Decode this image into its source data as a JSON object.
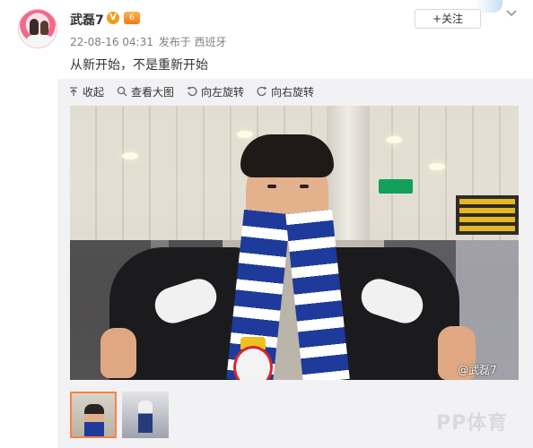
{
  "header": {
    "username": "武磊7",
    "verified_badge": "V",
    "vip_badge": "6",
    "timestamp": "22-08-16 04:31",
    "source": "发布于 西班牙",
    "follow_label": "+关注",
    "more_icon": "chevron-down-icon"
  },
  "post": {
    "text": "从新开始，不是重新开始"
  },
  "toolbar": {
    "items": [
      {
        "label": "收起",
        "icon": "collapse-up-icon"
      },
      {
        "label": "查看大图",
        "icon": "zoom-search-icon"
      },
      {
        "label": "向左旋转",
        "icon": "rotate-left-icon"
      },
      {
        "label": "向右旋转",
        "icon": "rotate-right-icon"
      }
    ]
  },
  "photo": {
    "watermark": "@武磊7"
  },
  "brand_logo": "PP体育",
  "colors": {
    "accent": "#ff8140",
    "text": "#333333",
    "meta": "#808080",
    "panel_bg": "#f2f2f5"
  }
}
